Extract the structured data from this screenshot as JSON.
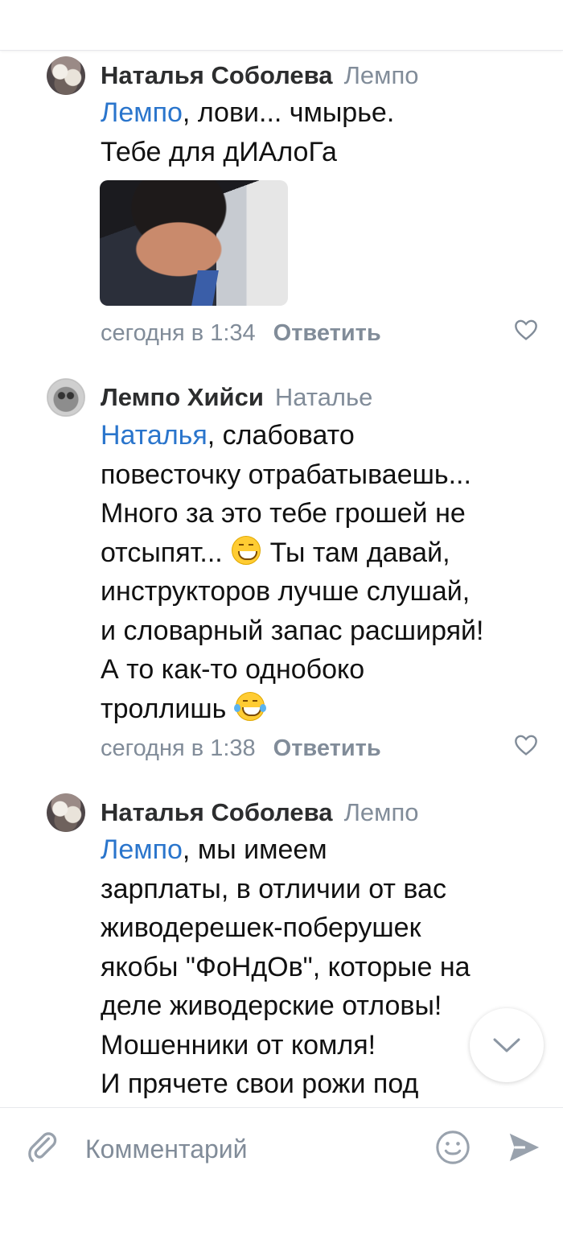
{
  "comments": [
    {
      "author": "Наталья Соболева",
      "reply_to": "Лемпо",
      "mention": "Лемпо",
      "lines": [
        ", лови... чмырье.",
        "Тебе для дИАлоГа"
      ],
      "time": "сегодня в 1:34",
      "reply_label": "Ответить",
      "has_photo": true
    },
    {
      "author": "Лемпо Хийси",
      "reply_to": "Наталье",
      "mention": "Наталья",
      "lines": [
        ", слабовато",
        "повесточку отрабатываешь...",
        "Много за это тебе грошей не",
        "отсыпят...",
        " Ты там давай,",
        "инструкторов лучше слушай,",
        "и словарный запас расширяй!",
        "А то как-то однобоко",
        "троллишь"
      ],
      "time": "сегодня в 1:38",
      "reply_label": "Ответить"
    },
    {
      "author": "Наталья Соболева",
      "reply_to": "Лемпо",
      "mention": "Лемпо",
      "lines": [
        ", мы имеем",
        "зарплаты, в отличии от вас",
        "живодерешек-поберушек",
        "якобы \"ФоНдОв\", которые на",
        "деле живодерские отловы!",
        "Мошенники от комля!",
        "И прячете свои рожи под"
      ]
    }
  ],
  "composer": {
    "placeholder": "Комментарий"
  },
  "colors": {
    "accent": "#2a75cc",
    "secondary_text": "#818c99"
  }
}
